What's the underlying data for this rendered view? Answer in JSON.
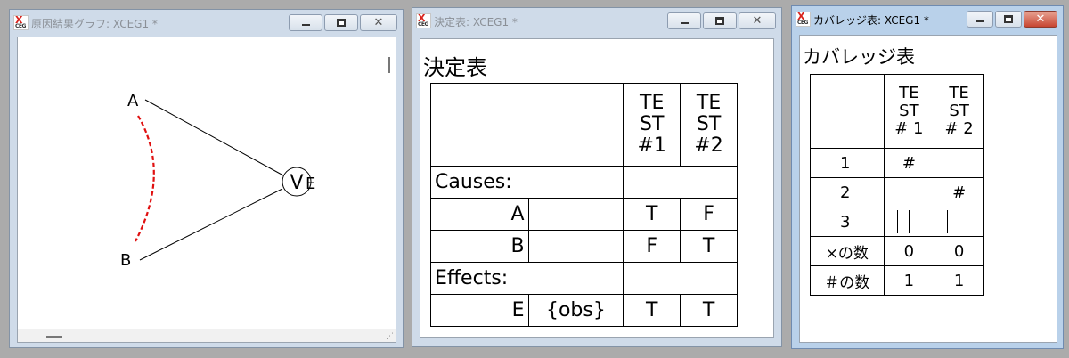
{
  "windows": {
    "graph": {
      "title": "原因結果グラフ: XCEG1 *",
      "nodes": {
        "a": "A",
        "b": "B",
        "e": "E",
        "op": "V"
      }
    },
    "decision": {
      "title": "決定表: XCEG1 *",
      "heading": "決定表",
      "tests": [
        "TE\nST\n#1",
        "TE\nST\n#2"
      ],
      "causes_label": "Causes:",
      "effects_label": "Effects:",
      "rows": [
        {
          "name": "A",
          "obs": "",
          "t1": "T",
          "t2": "F"
        },
        {
          "name": "B",
          "obs": "",
          "t1": "F",
          "t2": "T"
        }
      ],
      "effect_rows": [
        {
          "name": "E",
          "obs": "{obs}",
          "t1": "T",
          "t2": "T"
        }
      ]
    },
    "coverage": {
      "title": "カバレッジ表: XCEG1 *",
      "heading": "カバレッジ表",
      "tests": [
        "TE\nST\n# 1",
        "TE\nST\n# 2"
      ],
      "rows": [
        {
          "label": "1",
          "t1": "#",
          "t2": ""
        },
        {
          "label": "2",
          "t1": "",
          "t2": "#"
        },
        {
          "label": "3",
          "t1": "",
          "t2": ""
        },
        {
          "label": "×の数",
          "t1": "0",
          "t2": "0"
        },
        {
          "label": "＃の数",
          "t1": "1",
          "t2": "1"
        }
      ]
    }
  },
  "colors": {
    "constraint": "#e01010",
    "active_close": "#c74531"
  }
}
